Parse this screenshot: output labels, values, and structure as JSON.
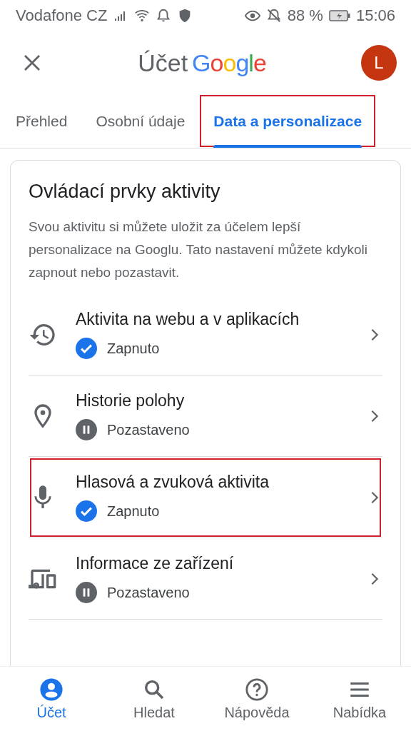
{
  "status_bar": {
    "carrier": "Vodafone CZ",
    "battery": "88 %",
    "time": "15:06"
  },
  "header": {
    "title": "Účet",
    "logo": "Google",
    "avatar": "L"
  },
  "tabs": [
    {
      "label": "Přehled",
      "selected": false,
      "highlighted": false
    },
    {
      "label": "Osobní údaje",
      "selected": false,
      "highlighted": false
    },
    {
      "label": "Data a personalizace",
      "selected": true,
      "highlighted": true
    }
  ],
  "card": {
    "title": "Ovládací prvky aktivity",
    "description": "Svou aktivitu si můžete uložit za účelem lepší personalizace na Googlu. Tato nastavení můžete kdykoli zapnout nebo pozastavit.",
    "items": [
      {
        "kind": "history",
        "label": "Aktivita na webu a v aplikacích",
        "status": "Zapnuto",
        "on": true,
        "highlighted": false
      },
      {
        "kind": "location",
        "label": "Historie polohy",
        "status": "Pozastaveno",
        "on": false,
        "highlighted": false
      },
      {
        "kind": "voice",
        "label": "Hlasová a zvuková aktivita",
        "status": "Zapnuto",
        "on": true,
        "highlighted": true
      },
      {
        "kind": "device",
        "label": "Informace ze zařízení",
        "status": "Pozastaveno",
        "on": false,
        "highlighted": false
      }
    ]
  },
  "bottom_nav": [
    {
      "kind": "account",
      "label": "Účet",
      "selected": true
    },
    {
      "kind": "search",
      "label": "Hledat",
      "selected": false
    },
    {
      "kind": "help",
      "label": "Nápověda",
      "selected": false
    },
    {
      "kind": "menu",
      "label": "Nabídka",
      "selected": false
    }
  ]
}
